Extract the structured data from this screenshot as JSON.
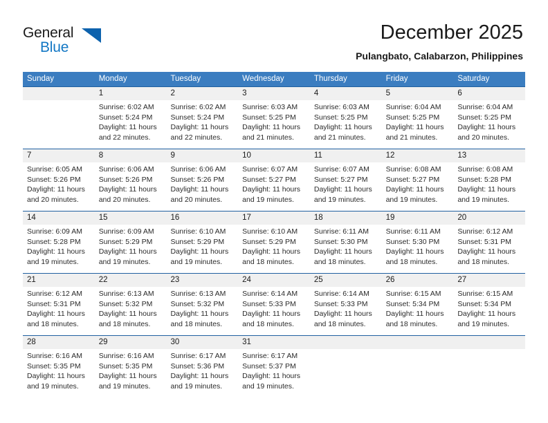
{
  "logo": {
    "word_top": "General",
    "word_bottom": "Blue",
    "triangle_color": "#0d62ad",
    "blue_color": "#1277c4"
  },
  "header": {
    "title": "December 2025",
    "subtitle": "Pulangbato, Calabarzon, Philippines"
  },
  "theme": {
    "header_blue": "#3b7dc0",
    "rule_blue": "#1f5fa0",
    "daynum_band": "#f0f0f0"
  },
  "weekday_labels": [
    "Sunday",
    "Monday",
    "Tuesday",
    "Wednesday",
    "Thursday",
    "Friday",
    "Saturday"
  ],
  "weeks": [
    [
      {
        "day": "",
        "sunrise": "",
        "sunset": "",
        "daylight": ""
      },
      {
        "day": "1",
        "sunrise": "Sunrise: 6:02 AM",
        "sunset": "Sunset: 5:24 PM",
        "daylight": "Daylight: 11 hours and 22 minutes."
      },
      {
        "day": "2",
        "sunrise": "Sunrise: 6:02 AM",
        "sunset": "Sunset: 5:24 PM",
        "daylight": "Daylight: 11 hours and 22 minutes."
      },
      {
        "day": "3",
        "sunrise": "Sunrise: 6:03 AM",
        "sunset": "Sunset: 5:25 PM",
        "daylight": "Daylight: 11 hours and 21 minutes."
      },
      {
        "day": "4",
        "sunrise": "Sunrise: 6:03 AM",
        "sunset": "Sunset: 5:25 PM",
        "daylight": "Daylight: 11 hours and 21 minutes."
      },
      {
        "day": "5",
        "sunrise": "Sunrise: 6:04 AM",
        "sunset": "Sunset: 5:25 PM",
        "daylight": "Daylight: 11 hours and 21 minutes."
      },
      {
        "day": "6",
        "sunrise": "Sunrise: 6:04 AM",
        "sunset": "Sunset: 5:25 PM",
        "daylight": "Daylight: 11 hours and 20 minutes."
      }
    ],
    [
      {
        "day": "7",
        "sunrise": "Sunrise: 6:05 AM",
        "sunset": "Sunset: 5:26 PM",
        "daylight": "Daylight: 11 hours and 20 minutes."
      },
      {
        "day": "8",
        "sunrise": "Sunrise: 6:06 AM",
        "sunset": "Sunset: 5:26 PM",
        "daylight": "Daylight: 11 hours and 20 minutes."
      },
      {
        "day": "9",
        "sunrise": "Sunrise: 6:06 AM",
        "sunset": "Sunset: 5:26 PM",
        "daylight": "Daylight: 11 hours and 20 minutes."
      },
      {
        "day": "10",
        "sunrise": "Sunrise: 6:07 AM",
        "sunset": "Sunset: 5:27 PM",
        "daylight": "Daylight: 11 hours and 19 minutes."
      },
      {
        "day": "11",
        "sunrise": "Sunrise: 6:07 AM",
        "sunset": "Sunset: 5:27 PM",
        "daylight": "Daylight: 11 hours and 19 minutes."
      },
      {
        "day": "12",
        "sunrise": "Sunrise: 6:08 AM",
        "sunset": "Sunset: 5:27 PM",
        "daylight": "Daylight: 11 hours and 19 minutes."
      },
      {
        "day": "13",
        "sunrise": "Sunrise: 6:08 AM",
        "sunset": "Sunset: 5:28 PM",
        "daylight": "Daylight: 11 hours and 19 minutes."
      }
    ],
    [
      {
        "day": "14",
        "sunrise": "Sunrise: 6:09 AM",
        "sunset": "Sunset: 5:28 PM",
        "daylight": "Daylight: 11 hours and 19 minutes."
      },
      {
        "day": "15",
        "sunrise": "Sunrise: 6:09 AM",
        "sunset": "Sunset: 5:29 PM",
        "daylight": "Daylight: 11 hours and 19 minutes."
      },
      {
        "day": "16",
        "sunrise": "Sunrise: 6:10 AM",
        "sunset": "Sunset: 5:29 PM",
        "daylight": "Daylight: 11 hours and 19 minutes."
      },
      {
        "day": "17",
        "sunrise": "Sunrise: 6:10 AM",
        "sunset": "Sunset: 5:29 PM",
        "daylight": "Daylight: 11 hours and 18 minutes."
      },
      {
        "day": "18",
        "sunrise": "Sunrise: 6:11 AM",
        "sunset": "Sunset: 5:30 PM",
        "daylight": "Daylight: 11 hours and 18 minutes."
      },
      {
        "day": "19",
        "sunrise": "Sunrise: 6:11 AM",
        "sunset": "Sunset: 5:30 PM",
        "daylight": "Daylight: 11 hours and 18 minutes."
      },
      {
        "day": "20",
        "sunrise": "Sunrise: 6:12 AM",
        "sunset": "Sunset: 5:31 PM",
        "daylight": "Daylight: 11 hours and 18 minutes."
      }
    ],
    [
      {
        "day": "21",
        "sunrise": "Sunrise: 6:12 AM",
        "sunset": "Sunset: 5:31 PM",
        "daylight": "Daylight: 11 hours and 18 minutes."
      },
      {
        "day": "22",
        "sunrise": "Sunrise: 6:13 AM",
        "sunset": "Sunset: 5:32 PM",
        "daylight": "Daylight: 11 hours and 18 minutes."
      },
      {
        "day": "23",
        "sunrise": "Sunrise: 6:13 AM",
        "sunset": "Sunset: 5:32 PM",
        "daylight": "Daylight: 11 hours and 18 minutes."
      },
      {
        "day": "24",
        "sunrise": "Sunrise: 6:14 AM",
        "sunset": "Sunset: 5:33 PM",
        "daylight": "Daylight: 11 hours and 18 minutes."
      },
      {
        "day": "25",
        "sunrise": "Sunrise: 6:14 AM",
        "sunset": "Sunset: 5:33 PM",
        "daylight": "Daylight: 11 hours and 18 minutes."
      },
      {
        "day": "26",
        "sunrise": "Sunrise: 6:15 AM",
        "sunset": "Sunset: 5:34 PM",
        "daylight": "Daylight: 11 hours and 18 minutes."
      },
      {
        "day": "27",
        "sunrise": "Sunrise: 6:15 AM",
        "sunset": "Sunset: 5:34 PM",
        "daylight": "Daylight: 11 hours and 19 minutes."
      }
    ],
    [
      {
        "day": "28",
        "sunrise": "Sunrise: 6:16 AM",
        "sunset": "Sunset: 5:35 PM",
        "daylight": "Daylight: 11 hours and 19 minutes."
      },
      {
        "day": "29",
        "sunrise": "Sunrise: 6:16 AM",
        "sunset": "Sunset: 5:35 PM",
        "daylight": "Daylight: 11 hours and 19 minutes."
      },
      {
        "day": "30",
        "sunrise": "Sunrise: 6:17 AM",
        "sunset": "Sunset: 5:36 PM",
        "daylight": "Daylight: 11 hours and 19 minutes."
      },
      {
        "day": "31",
        "sunrise": "Sunrise: 6:17 AM",
        "sunset": "Sunset: 5:37 PM",
        "daylight": "Daylight: 11 hours and 19 minutes."
      },
      {
        "day": "",
        "sunrise": "",
        "sunset": "",
        "daylight": ""
      },
      {
        "day": "",
        "sunrise": "",
        "sunset": "",
        "daylight": ""
      },
      {
        "day": "",
        "sunrise": "",
        "sunset": "",
        "daylight": ""
      }
    ]
  ]
}
